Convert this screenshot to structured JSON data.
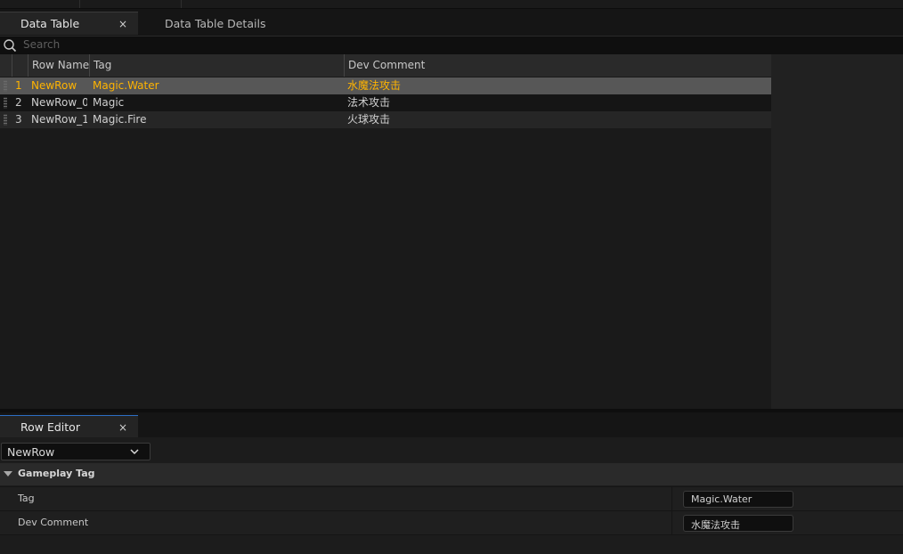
{
  "top_tabs": [
    {
      "label": "Data Table",
      "close": "×"
    },
    {
      "label": "Data Table Details"
    }
  ],
  "search": {
    "placeholder": "Search"
  },
  "table": {
    "columns": [
      "Row Name",
      "Tag",
      "Dev Comment"
    ],
    "rows": [
      {
        "index": "1",
        "row_name": "NewRow",
        "tag": "Magic.Water",
        "comment": "水魔法攻击",
        "selected": true
      },
      {
        "index": "2",
        "row_name": "NewRow_0",
        "tag": "Magic",
        "comment": "法术攻击",
        "selected": false
      },
      {
        "index": "3",
        "row_name": "NewRow_1",
        "tag": "Magic.Fire",
        "comment": "火球攻击",
        "selected": false
      }
    ]
  },
  "row_editor": {
    "tab_label": "Row Editor",
    "close": "×",
    "selected_row": "NewRow",
    "category": "Gameplay Tag",
    "properties": [
      {
        "name": "Tag",
        "value": "Magic.Water"
      },
      {
        "name": "Dev Comment",
        "value": "水魔法攻击"
      }
    ]
  },
  "colors": {
    "selected_text": "#ffb400",
    "selected_bg": "#575757",
    "accent": "#2d6fc4"
  },
  "icons": {
    "search": "search-icon",
    "close": "close-icon",
    "chevron": "chevron-down-icon",
    "collapse": "triangle-down-icon",
    "grip": "drag-handle-icon"
  }
}
